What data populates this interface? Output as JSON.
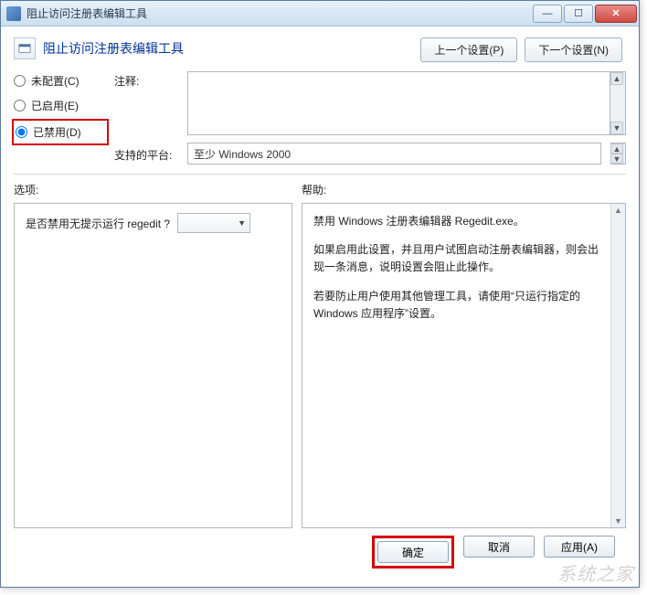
{
  "window": {
    "title": "阻止访问注册表编辑工具"
  },
  "header": {
    "title": "阻止访问注册表编辑工具",
    "prev_btn": "上一个设置(P)",
    "next_btn": "下一个设置(N)"
  },
  "radios": {
    "not_configured": "未配置(C)",
    "enabled": "已启用(E)",
    "disabled": "已禁用(D)",
    "selected": "disabled"
  },
  "meta": {
    "comment_label": "注释:",
    "comment_value": "",
    "platform_label": "支持的平台:",
    "platform_value": "至少 Windows 2000"
  },
  "sections": {
    "options_label": "选项:",
    "help_label": "帮助:"
  },
  "options": {
    "question": "是否禁用无提示运行 regedit ?",
    "combo_value": ""
  },
  "help": {
    "p1": "禁用 Windows 注册表编辑器 Regedit.exe。",
    "p2": "如果启用此设置，并且用户试图启动注册表编辑器，则会出现一条消息，说明设置会阻止此操作。",
    "p3": "若要防止用户使用其他管理工具，请使用“只运行指定的 Windows 应用程序”设置。"
  },
  "footer": {
    "ok": "确定",
    "cancel": "取消",
    "apply": "应用(A)"
  }
}
